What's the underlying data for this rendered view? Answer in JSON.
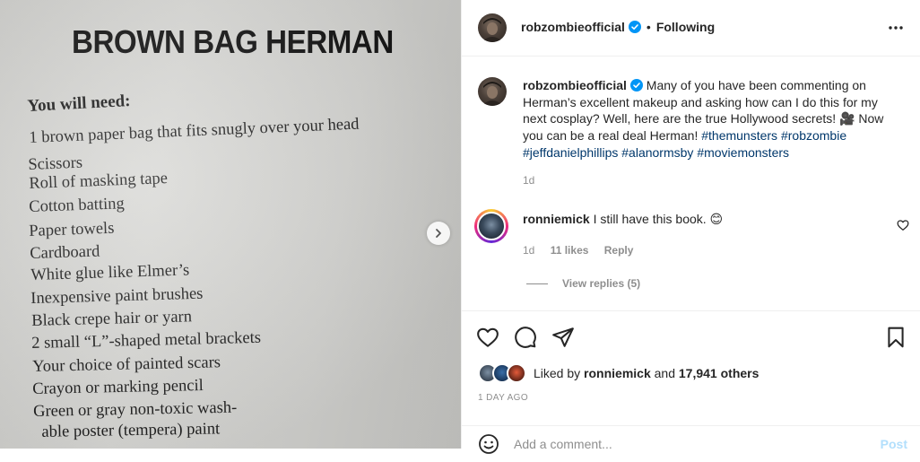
{
  "photo": {
    "book_title": "BROWN BAG HERMAN",
    "need_heading": "You will need:",
    "materials": [
      "1 brown paper bag that fits snugly over your head",
      "Scissors",
      "Roll of masking tape",
      "Cotton batting",
      "Paper towels",
      "Cardboard",
      "White glue like Elmer’s",
      "Inexpensive paint brushes",
      "Black crepe hair or yarn",
      "2 small “L”-shaped metal brackets",
      "Your choice of  painted scars",
      "Crayon or marking pencil",
      "Green or gray non-toxic wash-",
      "  able poster (tempera) paint"
    ],
    "next_icon": "chevron-right-icon"
  },
  "header": {
    "username": "robzombieofficial",
    "separator": "•",
    "follow_status": "Following",
    "more_icon": "more-options-icon"
  },
  "caption": {
    "username": "robzombieofficial",
    "text": "Many of you have been commenting on Herman’s excellent makeup and asking how can I do this for my next cosplay? Well, here are the true Hollywood secrets! 🎥 Now you can be a real deal Herman!",
    "hashtags": [
      "#themunsters",
      "#robzombie",
      "#jeffdanielphillips",
      "#alanormsby",
      "#moviemonsters"
    ],
    "time": "1d"
  },
  "comments": [
    {
      "username": "ronniemick",
      "text": "I still have this book. 😊",
      "time": "1d",
      "likes": "11 likes",
      "reply_label": "Reply",
      "view_replies": "View replies (5)"
    }
  ],
  "actions": {
    "like_icon": "heart-icon",
    "comment_icon": "comment-icon",
    "share_icon": "share-icon",
    "save_icon": "bookmark-icon"
  },
  "likes": {
    "prefix": "Liked by",
    "user": "ronniemick",
    "middle": "and",
    "count": "17,941 others"
  },
  "post_age": "1 DAY AGO",
  "add_comment": {
    "placeholder": "Add a comment...",
    "post_label": "Post"
  },
  "colors": {
    "link": "#00376b",
    "muted": "#8e8e8e",
    "verified": "#0095f6",
    "post_disabled": "#b2dffc"
  }
}
